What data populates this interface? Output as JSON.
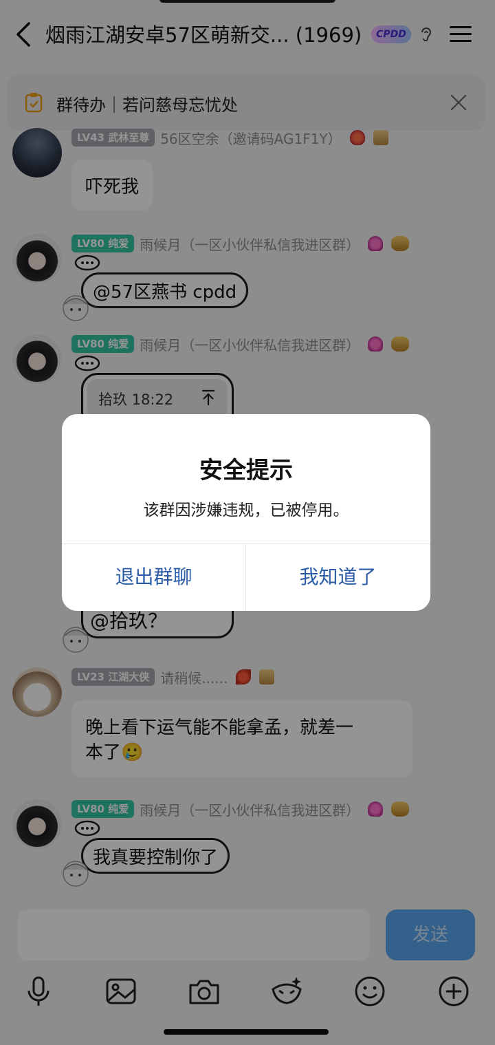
{
  "header": {
    "title": "烟雨江湖安卓57区萌新交... (1969)",
    "tag": "CPDD"
  },
  "todo": {
    "text": "群待办｜若问慈母忘忧处"
  },
  "messages": [
    {
      "level": "LV43 武林至尊",
      "nick": "56区空余（邀请码AG1F1Y）",
      "text": "吓死我"
    },
    {
      "level": "LV80 纯爱",
      "nick": "雨候月（一区小伙伴私信我进区群）",
      "text": "@57区燕书 cpdd"
    },
    {
      "level": "LV80 纯爱",
      "nick": "雨候月（一区小伙伴私信我进区群）",
      "quote": "拾玖 18:22",
      "text": "@拾玖？"
    },
    {
      "level": "LV23 江湖大侠",
      "nick": "请稍候......",
      "text_line1": "晚上看下运气能不能拿孟，就差一",
      "text_line2": "本了🥲"
    },
    {
      "level": "LV80 纯爱",
      "nick": "雨候月（一区小伙伴私信我进区群）",
      "text": "我真要控制你了"
    }
  ],
  "input": {
    "send_label": "发送"
  },
  "dialog": {
    "title": "安全提示",
    "message": "该群因涉嫌违规，已被停用。",
    "exit_label": "退出群聊",
    "ok_label": "我知道了"
  },
  "colors": {
    "accent_blue": "#2a5caa",
    "send_button": "#5aa7f0",
    "level_green": "#35c7a4"
  }
}
